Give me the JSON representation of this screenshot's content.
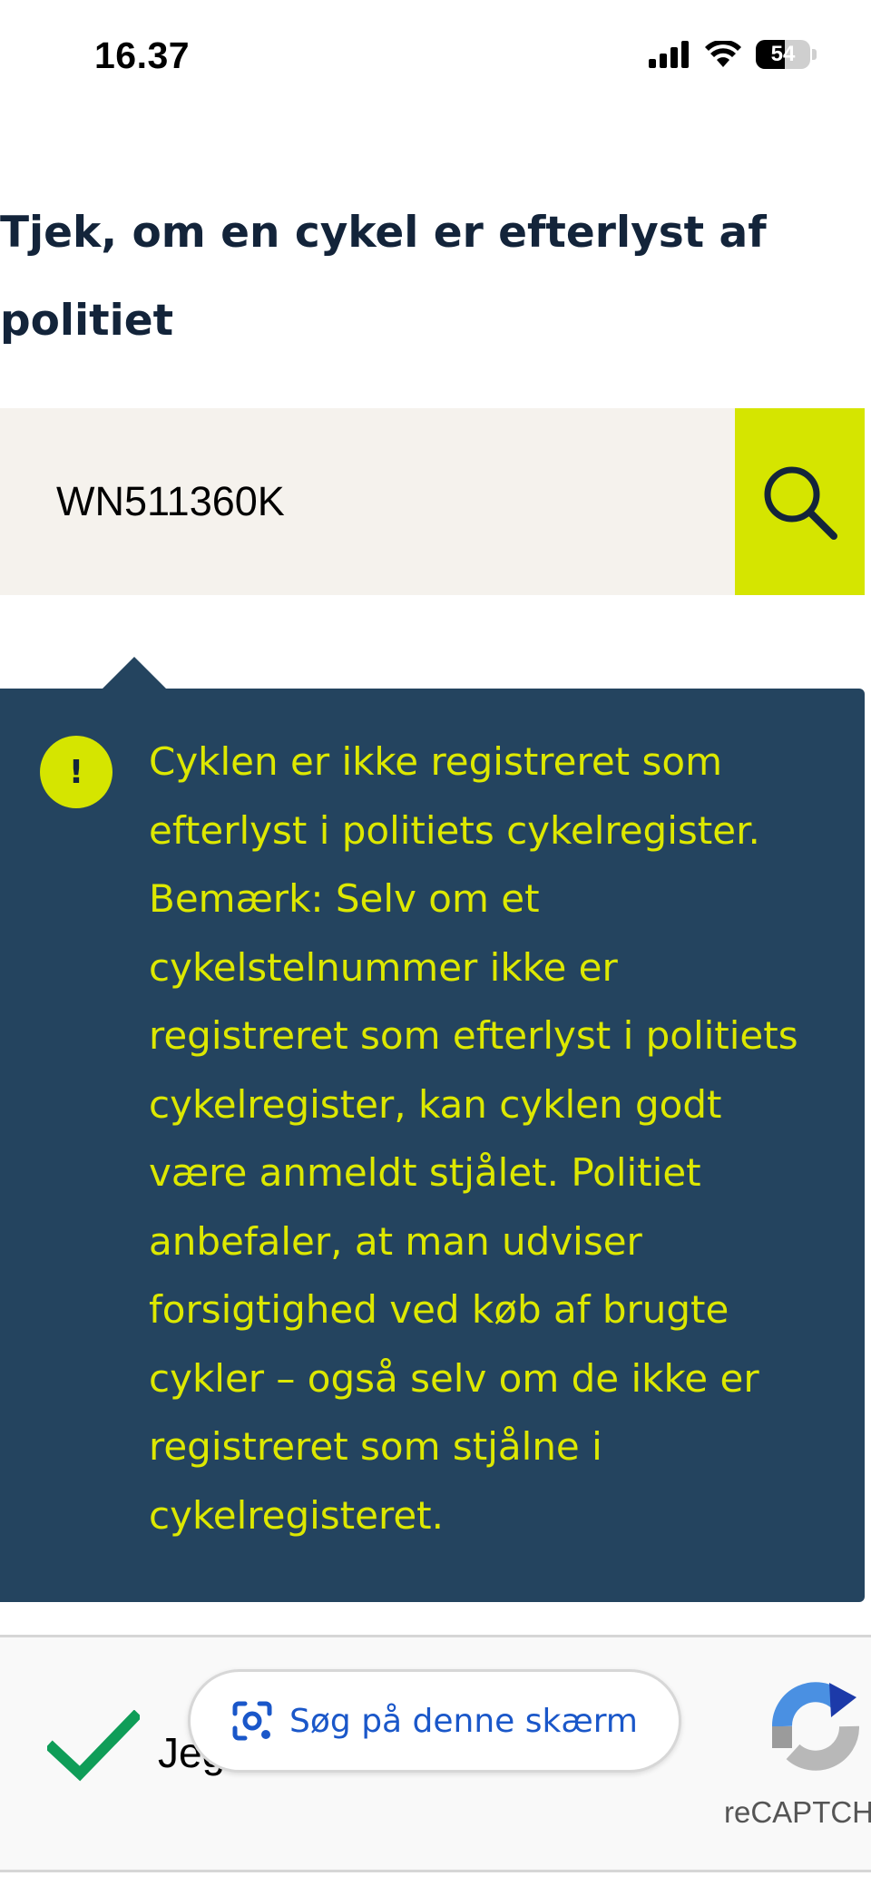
{
  "status_bar": {
    "time": "16.37",
    "battery_level": "54"
  },
  "page": {
    "title": "Tjek, om en cykel er efterlyst af politiet"
  },
  "search": {
    "value": "WN511360K",
    "button_icon": "search-icon"
  },
  "result": {
    "icon": "!",
    "message": "Cyklen er ikke registreret som efterlyst i politiets cykelregister. Bemærk: Selv om et cykelstelnummer ikke er registreret som efterlyst i politiets cykelregister, kan cyklen godt være anmeldt stjålet. Politiet anbefaler, at man udviser forsigtighed ved køb af brugte cykler – også selv om de ikke er registreret som stjålne i cykelregisteret."
  },
  "recaptcha": {
    "label": "Jeg",
    "brand": "reCAPTCHA"
  },
  "lens": {
    "label": "Søg på denne skærm",
    "icon": "lens-icon"
  },
  "colors": {
    "navy": "#24445f",
    "accent": "#d5e500",
    "notice_text": "#dde800",
    "search_bg": "#f5f2ed",
    "link_blue": "#1a57c9",
    "check_green": "#0f9d58"
  }
}
